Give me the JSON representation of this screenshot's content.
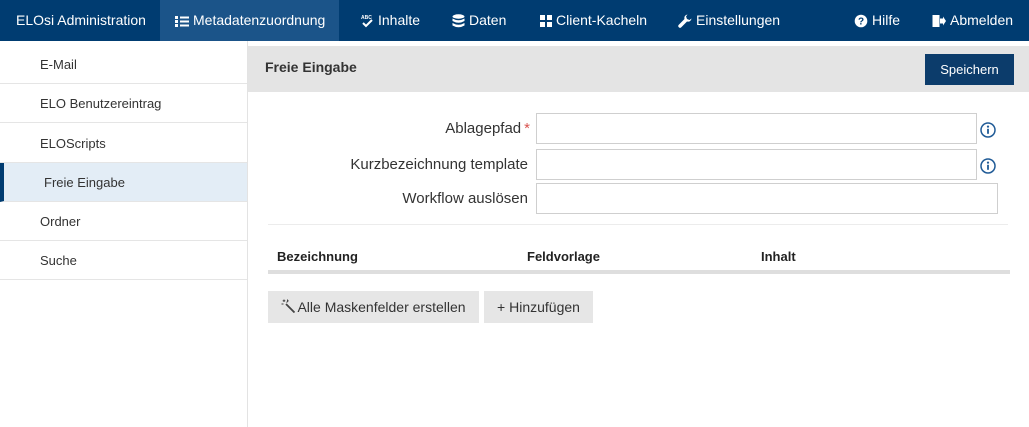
{
  "topbar": {
    "brand": "ELOsi Administration",
    "items": [
      {
        "label": "Metadatenzuordnung",
        "icon": "list-icon"
      },
      {
        "label": "Inhalte",
        "icon": "spellcheck-icon"
      },
      {
        "label": "Daten",
        "icon": "database-icon"
      },
      {
        "label": "Client-Kacheln",
        "icon": "tiles-icon"
      },
      {
        "label": "Einstellungen",
        "icon": "wrench-icon"
      }
    ],
    "help_label": "Hilfe",
    "logout_label": "Abmelden"
  },
  "sidebar": {
    "items": [
      {
        "label": "E-Mail"
      },
      {
        "label": "ELO Benutzereintrag"
      },
      {
        "label": "ELOScripts"
      },
      {
        "label": "Freie Eingabe"
      },
      {
        "label": "Ordner"
      },
      {
        "label": "Suche"
      }
    ],
    "active_index": 3
  },
  "main": {
    "title": "Freie Eingabe",
    "save_label": "Speichern",
    "form": {
      "ablagepfad_label": "Ablagepfad",
      "required_mark": "*",
      "ablagepfad_value": "",
      "kurzbezeichnung_label": "Kurzbezeichnung template",
      "kurzbezeichnung_value": "",
      "workflow_label": "Workflow auslösen",
      "workflow_value": ""
    },
    "table": {
      "columns": [
        "Bezeichnung",
        "Feldvorlage",
        "Inhalt"
      ]
    },
    "buttons": {
      "create_all_label": "Alle Maskenfelder erstellen",
      "add_label": "+ Hinzufügen"
    }
  },
  "colors": {
    "topbar_bg": "#003c71",
    "topbar_active": "#1b5489",
    "accent": "#0c3c6b",
    "required": "#d9534f",
    "info_icon": "#1f5a96"
  }
}
